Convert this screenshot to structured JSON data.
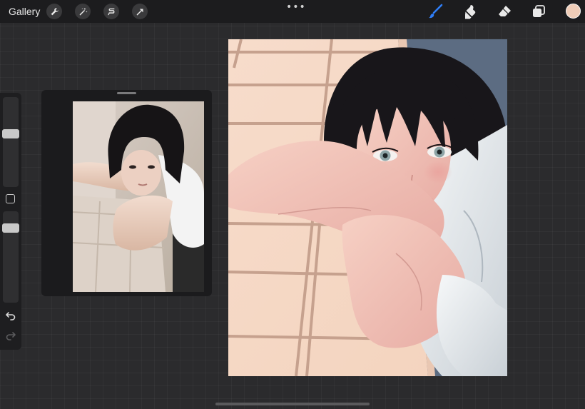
{
  "topbar": {
    "gallery_label": "Gallery",
    "more_label": "•••",
    "left_tools": [
      "wrench-icon",
      "magic-wand-icon",
      "selection-icon",
      "transform-arrow-icon"
    ],
    "right_tools": [
      "brush-icon",
      "smudge-icon",
      "eraser-icon",
      "layers-icon"
    ],
    "active_tool": "brush-icon",
    "accent_color": "#2f7df6",
    "current_color": "#f0cdb8"
  },
  "sidebar": {
    "brush_size_level": 0.6,
    "opacity_level": 0.85,
    "icons": [
      "modify-square-icon",
      "undo-icon",
      "redo-icon"
    ]
  },
  "reference": {
    "kind": "reference photo of a woman resting chin on crossed arms"
  },
  "colors": {
    "canvas_tile": "#f5d6c1",
    "canvas_grout": "#c6a18e",
    "canvas_shadow": "#586a80",
    "hair": "#18161a",
    "skin": "#f1c5bd",
    "shirt": "#eef1f3"
  }
}
